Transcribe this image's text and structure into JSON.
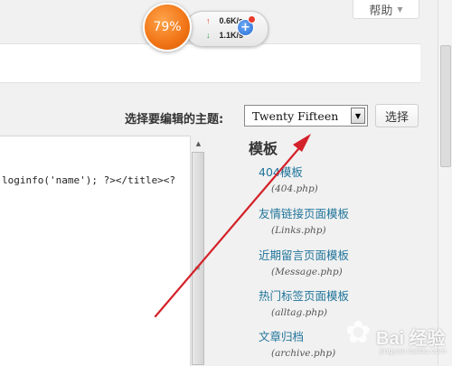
{
  "header": {
    "help_label": "帮助",
    "help_caret": "▼"
  },
  "speed_widget": {
    "percent": "79%",
    "upload": "0.6K/s",
    "download": "1.1K/s",
    "plus": "+",
    "up_arrow": "↑",
    "down_arrow": "↓"
  },
  "theme_picker": {
    "label": "选择要编辑的主题:",
    "selected": "Twenty Fifteen",
    "dropdown_glyph": "▼",
    "select_button": "选择"
  },
  "editor": {
    "visible_line": "loginfo('name'); ?></title><?",
    "scroll_up_glyph": "▲",
    "grip_glyph": "≡"
  },
  "templates": {
    "title": "模板",
    "items": [
      {
        "name": "404模板",
        "file": "(404.php)"
      },
      {
        "name": "友情链接页面模板",
        "file": "(Links.php)"
      },
      {
        "name": "近期留言页面模板",
        "file": "(Message.php)"
      },
      {
        "name": "热门标签页面模板",
        "file": "(alltag.php)"
      },
      {
        "name": "文章归档",
        "file": "(archive.php)"
      }
    ]
  },
  "watermark": {
    "text": "Bai 经验",
    "sub": "jingyan.baidu.com"
  },
  "colors": {
    "link": "#21759b",
    "annotation_arrow": "#d4222a",
    "speed_ball": "#f07415"
  },
  "icons": [
    "up-arrow-icon",
    "down-arrow-icon",
    "plus-icon",
    "dropdown-icon",
    "bear-paw-icon"
  ]
}
